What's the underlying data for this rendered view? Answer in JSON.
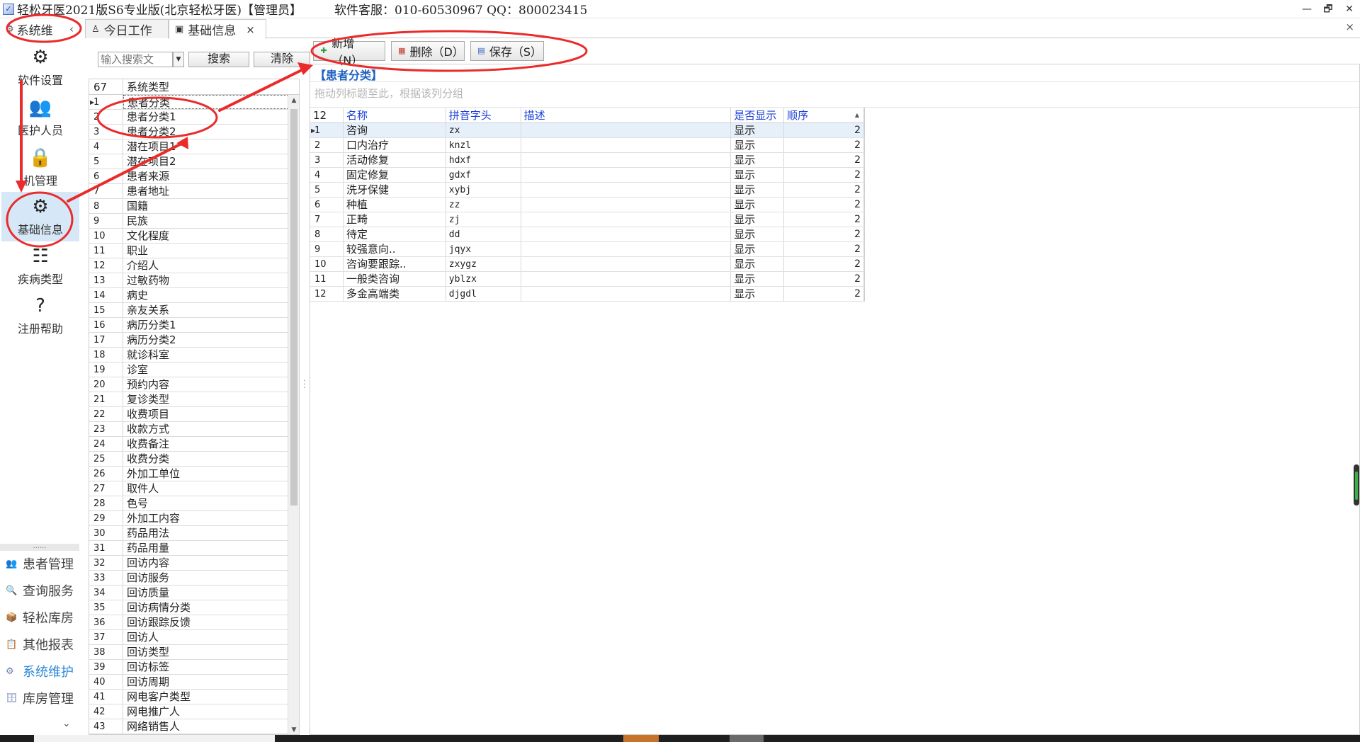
{
  "window": {
    "title": "轻松牙医2021版S6专业版(北京轻松牙医)【管理员】",
    "service": "软件客服：010-60530967 QQ：800023415",
    "controls": [
      "—",
      "🗗",
      "✕"
    ]
  },
  "nav": {
    "header": "系统维",
    "collapse": "‹",
    "items": [
      {
        "label": "软件设置",
        "icon": "gears-icon",
        "glyph": "⚙"
      },
      {
        "label": "医护人员",
        "icon": "staff-icon",
        "glyph": "👥"
      },
      {
        "label": "机管理",
        "icon": "lock-icon",
        "glyph": "🔒"
      },
      {
        "label": "基础信息",
        "icon": "base-info-icon",
        "glyph": "⚙"
      },
      {
        "label": "疾病类型",
        "icon": "disease-tree-icon",
        "glyph": "☷"
      },
      {
        "label": "注册帮助",
        "icon": "help-book-icon",
        "glyph": "?"
      }
    ],
    "dots": "......",
    "modules": [
      {
        "label": "患者管理",
        "icon": "patients-icon",
        "glyph": "👥"
      },
      {
        "label": "查询服务",
        "icon": "query-icon",
        "glyph": "🔍"
      },
      {
        "label": "轻松库房",
        "icon": "warehouse-icon",
        "glyph": "📦"
      },
      {
        "label": "其他报表",
        "icon": "report-icon",
        "glyph": "📋"
      },
      {
        "label": "系统维护",
        "icon": "maintenance-icon",
        "glyph": "⚙"
      },
      {
        "label": "库房管理",
        "icon": "storage-icon",
        "glyph": "🗄"
      }
    ],
    "more": "⌄"
  },
  "tabs": [
    {
      "label": "今日工作",
      "icon": "today-icon"
    },
    {
      "label": "基础信息",
      "icon": "info-icon"
    }
  ],
  "list": {
    "search_placeholder": "输入搜索文",
    "search_btn": "搜索",
    "clear_btn": "清除",
    "count": "67",
    "col_title": "系统类型",
    "rows": [
      [
        "1",
        "患者分类"
      ],
      [
        "2",
        "患者分类1"
      ],
      [
        "3",
        "患者分类2"
      ],
      [
        "4",
        "潜在项目1"
      ],
      [
        "5",
        "潜在项目2"
      ],
      [
        "6",
        "患者来源"
      ],
      [
        "7",
        "患者地址"
      ],
      [
        "8",
        "国籍"
      ],
      [
        "9",
        "民族"
      ],
      [
        "10",
        "文化程度"
      ],
      [
        "11",
        "职业"
      ],
      [
        "12",
        "介绍人"
      ],
      [
        "13",
        "过敏药物"
      ],
      [
        "14",
        "病史"
      ],
      [
        "15",
        "亲友关系"
      ],
      [
        "16",
        "病历分类1"
      ],
      [
        "17",
        "病历分类2"
      ],
      [
        "18",
        "就诊科室"
      ],
      [
        "19",
        "诊室"
      ],
      [
        "20",
        "预约内容"
      ],
      [
        "21",
        "复诊类型"
      ],
      [
        "22",
        "收费项目"
      ],
      [
        "23",
        "收款方式"
      ],
      [
        "24",
        "收费备注"
      ],
      [
        "25",
        "收费分类"
      ],
      [
        "26",
        "外加工单位"
      ],
      [
        "27",
        "取件人"
      ],
      [
        "28",
        "色号"
      ],
      [
        "29",
        "外加工内容"
      ],
      [
        "30",
        "药品用法"
      ],
      [
        "31",
        "药品用量"
      ],
      [
        "32",
        "回访内容"
      ],
      [
        "33",
        "回访服务"
      ],
      [
        "34",
        "回访质量"
      ],
      [
        "35",
        "回访病情分类"
      ],
      [
        "36",
        "回访跟踪反馈"
      ],
      [
        "37",
        "回访人"
      ],
      [
        "38",
        "回访类型"
      ],
      [
        "39",
        "回访标签"
      ],
      [
        "40",
        "回访周期"
      ],
      [
        "41",
        "网电客户类型"
      ],
      [
        "42",
        "网电推广人"
      ],
      [
        "43",
        "网络销售人"
      ]
    ]
  },
  "detail": {
    "toolbar": {
      "add": "新增（N）",
      "delete": "删除（D）",
      "save": "保存（S）"
    },
    "group_title": "【患者分类】",
    "group_hint": "拖动列标题至此，根据该列分组",
    "count": "12",
    "columns": [
      "名称",
      "拼音字头",
      "描述",
      "是否显示",
      "顺序"
    ],
    "rows": [
      [
        "1",
        "咨询",
        "zx",
        "",
        "显示",
        "2"
      ],
      [
        "2",
        "口内治疗",
        "knzl",
        "",
        "显示",
        "2"
      ],
      [
        "3",
        "活动修复",
        "hdxf",
        "",
        "显示",
        "2"
      ],
      [
        "4",
        "固定修复",
        "gdxf",
        "",
        "显示",
        "2"
      ],
      [
        "5",
        "洗牙保健",
        "xybj",
        "",
        "显示",
        "2"
      ],
      [
        "6",
        "种植",
        "zz",
        "",
        "显示",
        "2"
      ],
      [
        "7",
        "正畸",
        "zj",
        "",
        "显示",
        "2"
      ],
      [
        "8",
        "待定",
        "dd",
        "",
        "显示",
        "2"
      ],
      [
        "9",
        "较强意向..",
        "jqyx",
        "",
        "显示",
        "2"
      ],
      [
        "10",
        "咨询要跟踪..",
        "zxygz",
        "",
        "显示",
        "2"
      ],
      [
        "11",
        "一般类咨询",
        "yblzx",
        "",
        "显示",
        "2"
      ],
      [
        "12",
        "多金高端类",
        "djgdl",
        "",
        "显示",
        "2"
      ]
    ]
  },
  "colors": {
    "accent": "#2a86d6",
    "annotation": "#ea2b2b",
    "header_blue": "#1a3fd6",
    "selection": "#d6e7f7"
  }
}
